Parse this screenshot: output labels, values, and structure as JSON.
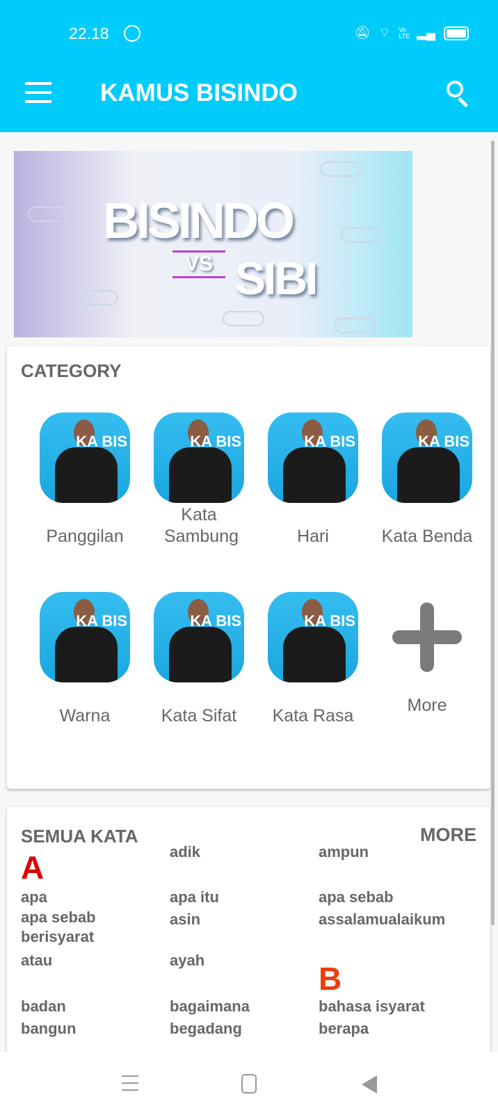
{
  "status_bar": {
    "time": "22.18",
    "icons": [
      "whatsapp-icon",
      "mute-icon",
      "wifi-icon",
      "volte-icon",
      "signal-icon",
      "battery-icon"
    ],
    "volte": "Vo LTE"
  },
  "app_bar": {
    "title": "KAMUS BISINDO",
    "menu_icon": "hamburger-icon",
    "search_icon": "search-icon",
    "color": "#00ccfc"
  },
  "banner": {
    "text1": "BISINDO",
    "vs": "VS",
    "text2": "SIBI"
  },
  "category": {
    "title": "CATEGORY",
    "items": [
      {
        "label": "Panggilan"
      },
      {
        "label": "Kata Sambung"
      },
      {
        "label": "Hari"
      },
      {
        "label": "Kata Benda"
      },
      {
        "label": "Warna"
      },
      {
        "label": "Kata Sifat"
      },
      {
        "label": "Kata Rasa"
      },
      {
        "label": "More"
      }
    ],
    "thumb_text": "KA BIS"
  },
  "semua_kata": {
    "title": "SEMUA KATA",
    "more": "MORE",
    "letters": {
      "a": "A",
      "b": "B"
    },
    "letter_colors": {
      "a": "#e00000",
      "b": "#f03c0a"
    },
    "words": [
      "adik",
      "ampun",
      "apa",
      "apa itu",
      "apa sebab",
      "apa sebab berisyarat",
      "asin",
      "assalamualaikum",
      "atau",
      "ayah",
      "badan",
      "bagaimana",
      "bahasa isyarat",
      "bangun",
      "begadang",
      "berapa"
    ]
  }
}
